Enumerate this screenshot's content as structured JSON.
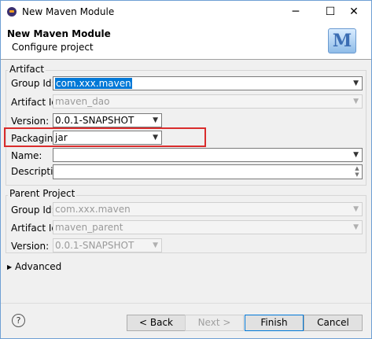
{
  "window": {
    "title": "New Maven Module",
    "min": "─",
    "max": "☐",
    "close": "✕"
  },
  "header": {
    "title": "New Maven Module",
    "subtitle": "Configure project",
    "logo_letter": "M"
  },
  "artifact": {
    "legend": "Artifact",
    "group_id_label": "Group Id:",
    "group_id_value": "com.xxx.maven",
    "artifact_id_label": "Artifact Id:",
    "artifact_id_value": "maven_dao",
    "version_label": "Version:",
    "version_value": "0.0.1-SNAPSHOT",
    "packaging_label": "Packaging:",
    "packaging_value": "jar",
    "name_label": "Name:",
    "name_value": "",
    "description_label": "Description:",
    "description_value": ""
  },
  "parent": {
    "legend": "Parent Project",
    "group_id_label": "Group Id:",
    "group_id_value": "com.xxx.maven",
    "artifact_id_label": "Artifact Id:",
    "artifact_id_value": "maven_parent",
    "version_label": "Version:",
    "version_value": "0.0.1-SNAPSHOT"
  },
  "advanced": {
    "arrow": "▶",
    "label": "Advanced"
  },
  "buttons": {
    "help": "?",
    "back": "< Back",
    "next": "Next >",
    "finish": "Finish",
    "cancel": "Cancel"
  }
}
